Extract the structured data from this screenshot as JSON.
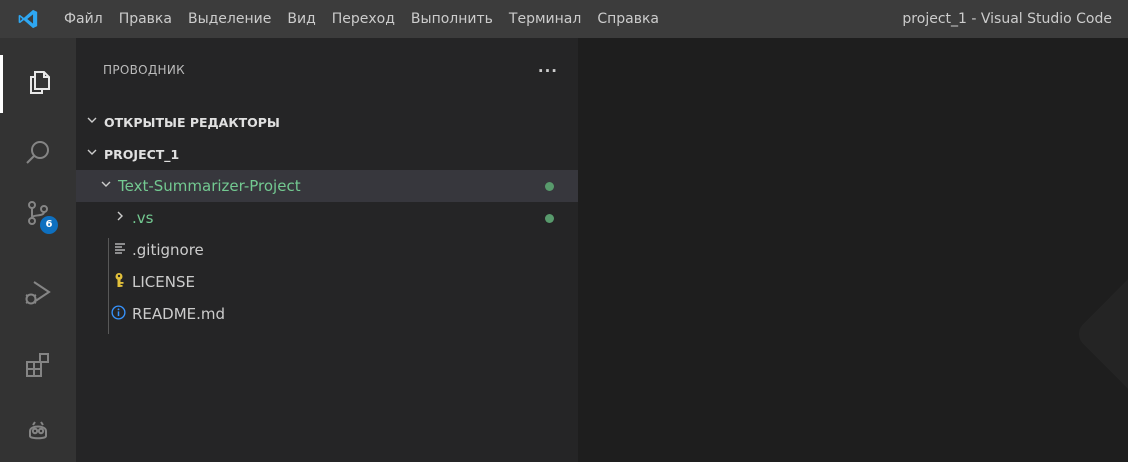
{
  "window": {
    "title": "project_1 - Visual Studio Code",
    "menu": [
      "Файл",
      "Правка",
      "Выделение",
      "Вид",
      "Переход",
      "Выполнить",
      "Терминал",
      "Справка"
    ]
  },
  "activity_bar": {
    "items": [
      {
        "icon": "explorer-icon",
        "active": true
      },
      {
        "icon": "search-icon"
      },
      {
        "icon": "source-control-icon",
        "badge": "6"
      },
      {
        "icon": "run-debug-icon"
      },
      {
        "icon": "extensions-icon"
      },
      {
        "icon": "copilot-icon"
      }
    ]
  },
  "explorer": {
    "title": "ПРОВОДНИК",
    "more": "···",
    "sections": {
      "open_editors": "ОТКРЫТЫЕ РЕДАКТОРЫ",
      "project": "PROJECT_1"
    },
    "tree": [
      {
        "label": "Text-Summarizer-Project",
        "type": "folder",
        "expanded": true,
        "git_modified": true
      },
      {
        "label": ".vs",
        "type": "folder",
        "expanded": false,
        "git_modified": true
      },
      {
        "label": ".gitignore",
        "type": "file",
        "icon": "lines-icon"
      },
      {
        "label": "LICENSE",
        "type": "file",
        "icon": "key-icon"
      },
      {
        "label": "README.md",
        "type": "file",
        "icon": "info-icon"
      }
    ]
  },
  "colors": {
    "accent": "#0e70c0",
    "git_modified": "#73c991",
    "license_icon": "#e2c03b",
    "info_icon": "#3794ff"
  }
}
